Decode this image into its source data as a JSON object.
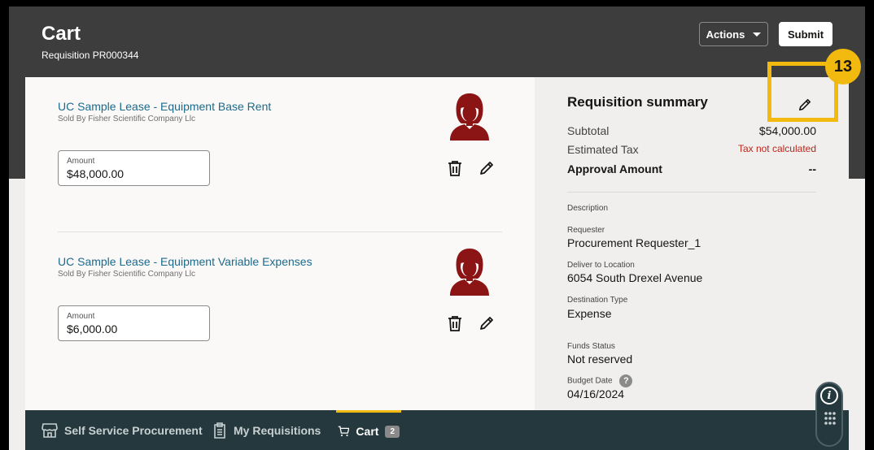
{
  "header": {
    "title": "Cart",
    "subtitle": "Requisition PR000344",
    "actions_label": "Actions",
    "submit_label": "Submit"
  },
  "lines": [
    {
      "title": "UC Sample Lease - Equipment Base Rent",
      "seller": "Sold By Fisher Scientific Company Llc",
      "amount_label": "Amount",
      "amount_value": "$48,000.00"
    },
    {
      "title": "UC Sample Lease - Equipment Variable Expenses",
      "seller": "Sold By Fisher Scientific Company Llc",
      "amount_label": "Amount",
      "amount_value": "$6,000.00"
    }
  ],
  "summary": {
    "title": "Requisition summary",
    "subtotal_label": "Subtotal",
    "subtotal_value": "$54,000.00",
    "tax_label": "Estimated Tax",
    "tax_value": "Tax not calculated",
    "approval_label": "Approval Amount",
    "approval_value": "--",
    "description_label": "Description",
    "requester_label": "Requester",
    "requester_value": "Procurement Requester_1",
    "deliver_label": "Deliver to Location",
    "deliver_value": "6054 South Drexel Avenue",
    "destination_label": "Destination Type",
    "destination_value": "Expense",
    "funds_label": "Funds Status",
    "funds_value": "Not reserved",
    "budget_label": "Budget Date",
    "budget_help": "?",
    "budget_value": "04/16/2024"
  },
  "callout": {
    "number": "13"
  },
  "nav": {
    "self_service": "Self Service Procurement",
    "my_requisitions": "My Requisitions",
    "cart": "Cart",
    "cart_count": "2"
  },
  "fab": {
    "info_glyph": "i"
  },
  "colors": {
    "header_bg": "#3d3d3d",
    "link": "#1b6a8c",
    "avatar": "#8b1414",
    "callout": "#f2b90f",
    "nav_bg": "#24383d",
    "warning": "#b8261c"
  },
  "icons": [
    "user-avatar-icon",
    "trash-icon",
    "pencil-icon",
    "store-icon",
    "clipboard-icon",
    "cart-icon",
    "info-icon",
    "keypad-icon",
    "chevron-down-icon"
  ]
}
